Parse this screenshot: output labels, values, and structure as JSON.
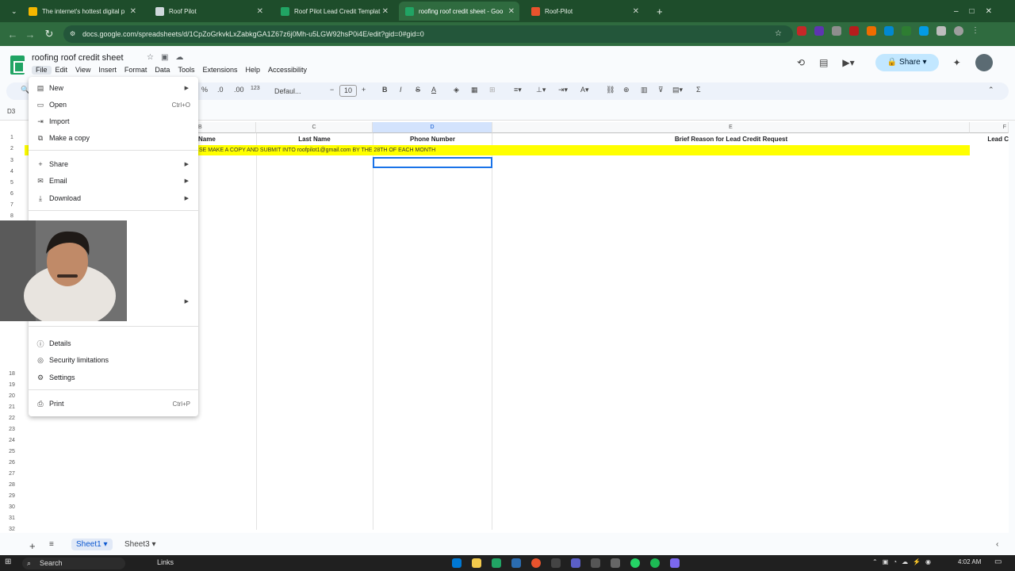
{
  "browser": {
    "tabs": [
      {
        "title": "The internet's hottest digital p",
        "icon": "star-icon",
        "color": "#f5b700"
      },
      {
        "title": "Roof Pilot",
        "icon": "site-icon",
        "color": "#cfd8dc"
      },
      {
        "title": "Roof Pilot Lead Credit Templat",
        "icon": "sheets-icon",
        "color": "#21a464"
      },
      {
        "title": "roofing roof credit sheet - Goo",
        "icon": "sheets-icon",
        "color": "#21a464"
      },
      {
        "title": "Roof-Pilot",
        "icon": "site-icon",
        "color": "#e8532d"
      }
    ],
    "new_tab": "+",
    "url": "docs.google.com/spreadsheets/d/1CpZoGrkvkLxZabkgGA1Z67z6j0Mh-u5LGW92hsP0i4E/edit?gid=0#gid=0"
  },
  "sheets": {
    "doc_title": "roofing roof credit sheet",
    "menu": [
      "File",
      "Edit",
      "View",
      "Insert",
      "Format",
      "Data",
      "Tools",
      "Extensions",
      "Help",
      "Accessibility"
    ],
    "share_label": "Share",
    "toolbar": {
      "percent": "%",
      "dec_dec": ".0",
      "dec_inc": ".00",
      "format_num": "123",
      "font": "Defaul...",
      "font_size": "10",
      "minus": "−",
      "plus": "+",
      "bold": "B",
      "italic": "I",
      "strike": "S",
      "text_color": "A"
    },
    "name_box": "D3",
    "columns": [
      {
        "letter": "C",
        "header": "Last Name"
      },
      {
        "letter": "D",
        "header": "Phone Number"
      },
      {
        "letter": "E",
        "header": "Brief Reason for Lead Credit Request"
      },
      {
        "letter": "F",
        "header": "Lead C"
      }
    ],
    "col_b_partial": "B",
    "col_b_header": "Name",
    "banner": "SE MAKE A COPY AND SUBMIT INTO roofpilot1@gmail.com  BY THE 28TH OF EACH MONTH",
    "rows": [
      "1",
      "2",
      "3",
      "4",
      "5",
      "6",
      "7",
      "8",
      "18",
      "19",
      "20",
      "21",
      "22",
      "23",
      "24",
      "25",
      "26",
      "27",
      "28",
      "29",
      "30",
      "31",
      "32",
      "33",
      "34",
      "35"
    ],
    "file_menu": [
      {
        "label": "New",
        "icon": "new-icon",
        "submenu": true
      },
      {
        "label": "Open",
        "icon": "folder-icon",
        "shortcut": "Ctrl+O"
      },
      {
        "label": "Import",
        "icon": "import-icon"
      },
      {
        "label": "Make a copy",
        "icon": "copy-icon"
      },
      {
        "label": "Share",
        "icon": "person-add-icon",
        "submenu": true
      },
      {
        "label": "Email",
        "icon": "email-icon",
        "submenu": true
      },
      {
        "label": "Download",
        "icon": "download-icon",
        "submenu": true
      },
      {
        "label": "Details",
        "icon": "info-icon"
      },
      {
        "label": "Security limitations",
        "icon": "security-icon"
      },
      {
        "label": "Settings",
        "icon": "settings-icon"
      },
      {
        "label": "Print",
        "icon": "print-icon",
        "shortcut": "Ctrl+P"
      }
    ],
    "sheet_tabs": [
      "Sheet1",
      "Sheet3"
    ]
  },
  "taskbar": {
    "search": "Search",
    "links": "Links",
    "time": "4:02 AM"
  }
}
